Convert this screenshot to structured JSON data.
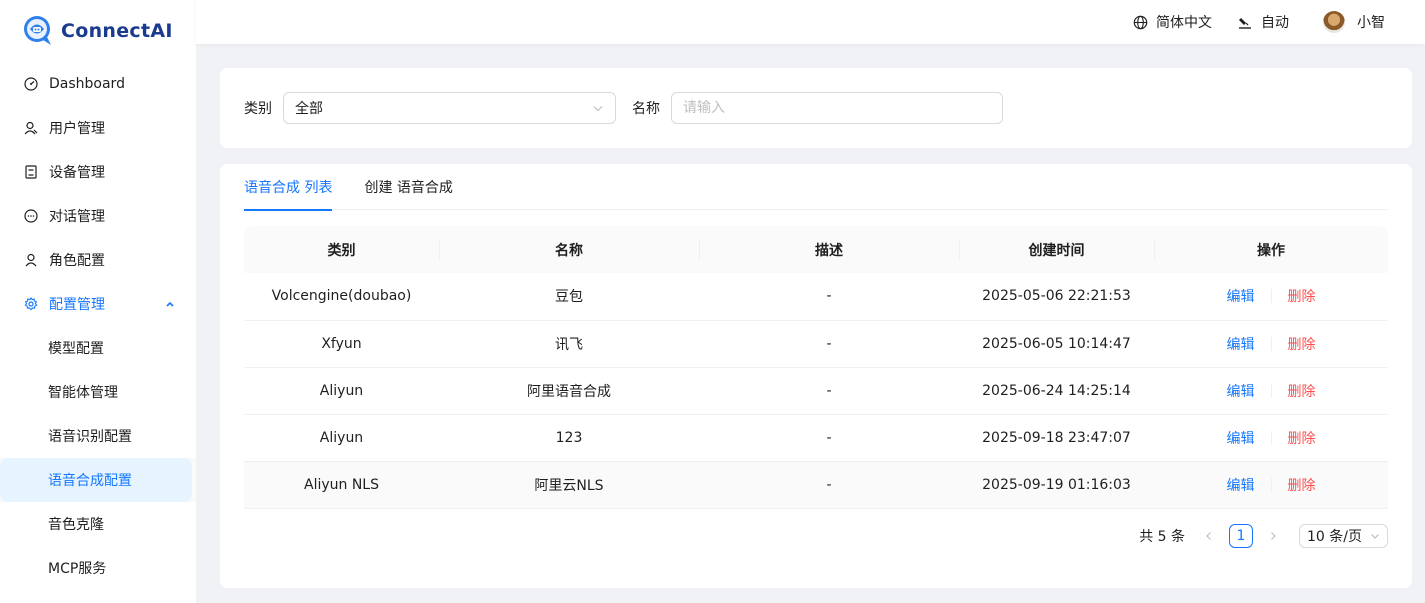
{
  "app": {
    "logo_text": "ConnectAI"
  },
  "header": {
    "language": "简体中文",
    "theme": "自动",
    "user": "小智"
  },
  "sidebar": {
    "items": [
      {
        "label": "Dashboard",
        "icon": "dashboard-icon"
      },
      {
        "label": "用户管理",
        "icon": "user-manage-icon"
      },
      {
        "label": "设备管理",
        "icon": "device-icon"
      },
      {
        "label": "对话管理",
        "icon": "chat-icon"
      },
      {
        "label": "角色配置",
        "icon": "role-icon"
      },
      {
        "label": "配置管理",
        "icon": "settings-icon"
      }
    ],
    "sub_items": [
      {
        "label": "模型配置"
      },
      {
        "label": "智能体管理"
      },
      {
        "label": "语音识别配置"
      },
      {
        "label": "语音合成配置"
      },
      {
        "label": "音色克隆"
      },
      {
        "label": "MCP服务"
      }
    ]
  },
  "filter": {
    "category_label": "类别",
    "category_value": "全部",
    "name_label": "名称",
    "name_placeholder": "请输入",
    "name_value": ""
  },
  "tabs": [
    {
      "label": "语音合成 列表"
    },
    {
      "label": "创建 语音合成"
    }
  ],
  "table": {
    "columns": [
      "类别",
      "名称",
      "描述",
      "创建时间",
      "操作"
    ],
    "rows": [
      {
        "category": "Volcengine(doubao)",
        "name": "豆包",
        "desc": "-",
        "created": "2025-05-06 22:21:53"
      },
      {
        "category": "Xfyun",
        "name": "讯飞",
        "desc": "-",
        "created": "2025-06-05 10:14:47"
      },
      {
        "category": "Aliyun",
        "name": "阿里语音合成",
        "desc": "-",
        "created": "2025-06-24 14:25:14"
      },
      {
        "category": "Aliyun",
        "name": "123",
        "desc": "-",
        "created": "2025-09-18 23:47:07"
      },
      {
        "category": "Aliyun NLS",
        "name": "阿里云NLS",
        "desc": "-",
        "created": "2025-09-19 01:16:03"
      }
    ],
    "edit_label": "编辑",
    "delete_label": "删除"
  },
  "pagination": {
    "total_text": "共 5 条",
    "current_page": "1",
    "page_size": "10 条/页"
  },
  "colors": {
    "accent": "#1677ff",
    "danger": "#ff4d4f"
  }
}
